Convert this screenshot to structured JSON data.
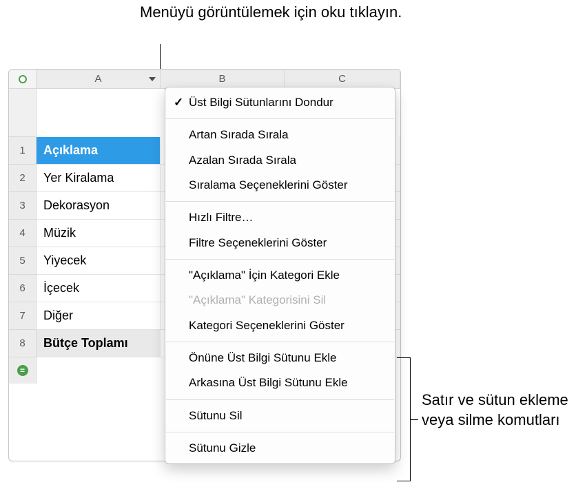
{
  "callouts": {
    "top": "Menüyü görüntülemek için oku tıklayın.",
    "right": "Satır ve sütun ekleme veya silme komutları"
  },
  "columns": [
    "A",
    "B",
    "C"
  ],
  "row_numbers": [
    "1",
    "2",
    "3",
    "4",
    "5",
    "6",
    "7",
    "8"
  ],
  "rows": [
    {
      "a": "Açıklama",
      "type": "header"
    },
    {
      "a": "Yer Kiralama",
      "type": "body"
    },
    {
      "a": "Dekorasyon",
      "type": "body"
    },
    {
      "a": "Müzik",
      "type": "body"
    },
    {
      "a": "Yiyecek",
      "type": "body"
    },
    {
      "a": "İçecek",
      "type": "body"
    },
    {
      "a": "Diğer",
      "type": "body"
    },
    {
      "a": "Bütçe Toplamı",
      "type": "footer"
    }
  ],
  "menu": {
    "groups": [
      [
        {
          "label": "Üst Bilgi Sütunlarını Dondur",
          "checked": true
        }
      ],
      [
        {
          "label": "Artan Sırada Sırala"
        },
        {
          "label": "Azalan Sırada Sırala"
        },
        {
          "label": "Sıralama Seçeneklerini Göster"
        }
      ],
      [
        {
          "label": "Hızlı Filtre…"
        },
        {
          "label": "Filtre Seçeneklerini Göster"
        }
      ],
      [
        {
          "label": "\"Açıklama\" İçin Kategori Ekle"
        },
        {
          "label": "\"Açıklama\" Kategorisini Sil",
          "disabled": true
        },
        {
          "label": "Kategori Seçeneklerini Göster"
        }
      ],
      [
        {
          "label": "Önüne Üst Bilgi Sütunu Ekle"
        },
        {
          "label": "Arkasına Üst Bilgi Sütunu Ekle"
        }
      ],
      [
        {
          "label": "Sütunu Sil"
        }
      ],
      [
        {
          "label": "Sütunu Gizle"
        }
      ]
    ]
  }
}
